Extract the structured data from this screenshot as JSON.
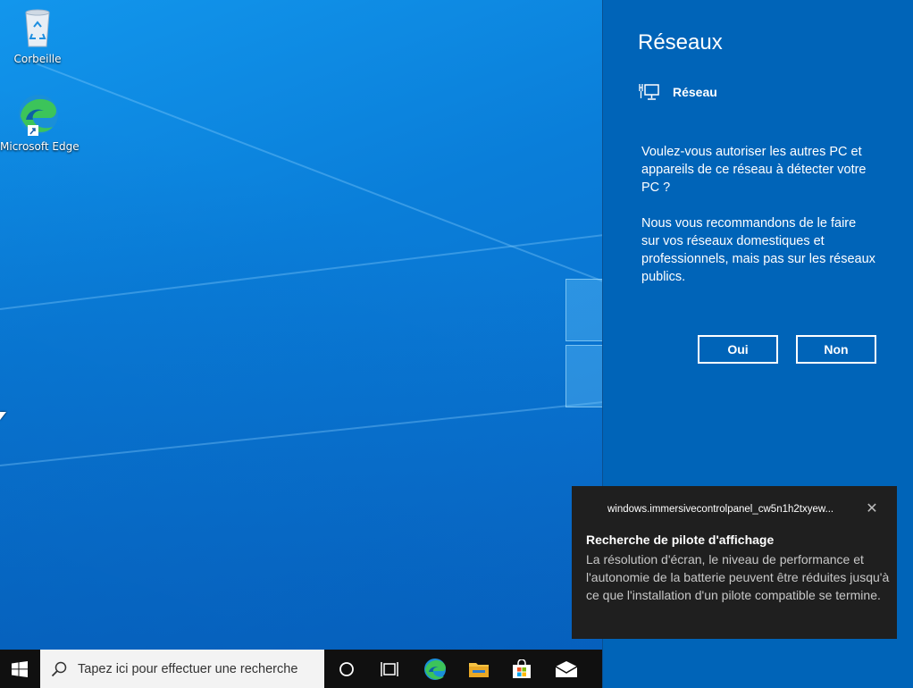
{
  "desktop": {
    "icons": [
      {
        "label": "Corbeille",
        "icon": "recycle-bin-icon"
      },
      {
        "label": "Microsoft Edge",
        "icon": "edge-icon"
      }
    ]
  },
  "network_panel": {
    "title": "Réseaux",
    "network_name": "Réseau",
    "network_icon": "ethernet-icon",
    "question": "Voulez-vous autoriser les autres PC et appareils de ce réseau à détecter votre PC ?",
    "recommendation": "Nous vous recommandons de le faire sur vos réseaux domestiques et professionnels, mais pas sur les réseaux publics.",
    "yes_label": "Oui",
    "no_label": "Non"
  },
  "toast": {
    "app_name": "windows.immersivecontrolpanel_cw5n1h2txyew...",
    "close_icon": "close-icon",
    "title": "Recherche de pilote d'affichage",
    "body": "La résolution d'écran, le niveau de performance et l'autonomie de la batterie peuvent être réduites jusqu'à ce que l'installation d'un pilote compatible se termine."
  },
  "taskbar": {
    "search_placeholder": "Tapez ici pour effectuer une recherche",
    "items": [
      "start-icon",
      "search-icon",
      "cortana-icon",
      "task-view-icon",
      "edge-icon",
      "file-explorer-icon",
      "store-icon",
      "mail-icon"
    ]
  },
  "colors": {
    "panel_bg": "#0064b8",
    "toast_bg": "#1f1f1f",
    "taskbar_bg": "#101010",
    "accent": "#0078d7"
  }
}
